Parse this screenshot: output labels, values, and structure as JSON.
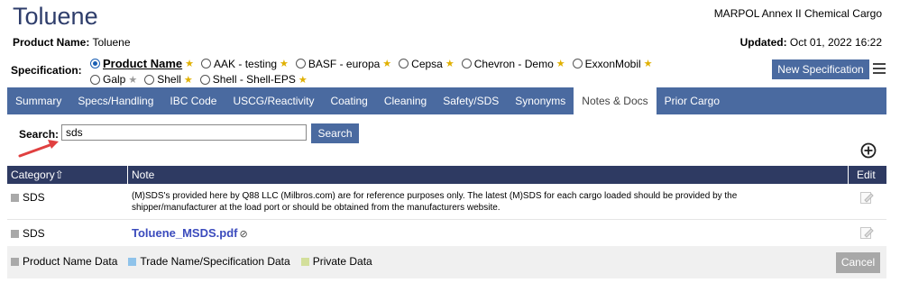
{
  "header": {
    "title": "Toluene",
    "marpol": "MARPOL Annex II Chemical Cargo",
    "product_label": "Product Name:",
    "product_value": "Toluene",
    "updated_label": "Updated:",
    "updated_value": "Oct 01, 2022 16:22"
  },
  "specification": {
    "label": "Specification:",
    "options": [
      {
        "label": "Product Name",
        "selected": true,
        "star": "gold"
      },
      {
        "label": "AAK - testing",
        "selected": false,
        "star": "gold"
      },
      {
        "label": "BASF - europa",
        "selected": false,
        "star": "gold"
      },
      {
        "label": "Cepsa",
        "selected": false,
        "star": "gold"
      },
      {
        "label": "Chevron - Demo",
        "selected": false,
        "star": "gold"
      },
      {
        "label": "ExxonMobil",
        "selected": false,
        "star": "gold"
      },
      {
        "label": "Galp",
        "selected": false,
        "star": "gray"
      },
      {
        "label": "Shell",
        "selected": false,
        "star": "gold"
      },
      {
        "label": "Shell - Shell-EPS",
        "selected": false,
        "star": "gold"
      }
    ],
    "new_button": "New Specification"
  },
  "tabs": [
    {
      "label": "Summary",
      "active": false
    },
    {
      "label": "Specs/Handling",
      "active": false
    },
    {
      "label": "IBC Code",
      "active": false
    },
    {
      "label": "USCG/Reactivity",
      "active": false
    },
    {
      "label": "Coating",
      "active": false
    },
    {
      "label": "Cleaning",
      "active": false
    },
    {
      "label": "Safety/SDS",
      "active": false
    },
    {
      "label": "Synonyms",
      "active": false
    },
    {
      "label": "Notes & Docs",
      "active": true
    },
    {
      "label": "Prior Cargo",
      "active": false
    }
  ],
  "search": {
    "label": "Search:",
    "value": "sds",
    "button": "Search"
  },
  "table": {
    "col_category": "Category",
    "col_note": "Note",
    "col_edit": "Edit",
    "rows": [
      {
        "category": "SDS",
        "note": "(M)SDS's provided here by Q88 LLC (Milbros.com) are for reference purposes only.  The latest (M)SDS for each cargo loaded should be provided by the shipper/manufacturer at the load port or should be obtained from the manufacturers website."
      },
      {
        "category": "SDS",
        "note": "Toluene_MSDS.pdf"
      }
    ]
  },
  "legend": [
    {
      "label": "Product Name Data",
      "color": "#a9a9a9"
    },
    {
      "label": "Trade Name/Specification Data",
      "color": "#8fc3ea"
    },
    {
      "label": "Private Data",
      "color": "#d3df9b"
    }
  ],
  "footer": {
    "cancel": "Cancel"
  },
  "colors": {
    "accent": "#4a6aa0",
    "header_dark": "#2e3a62",
    "title": "#2e3d6b",
    "annotation_arrow": "#e04040"
  }
}
